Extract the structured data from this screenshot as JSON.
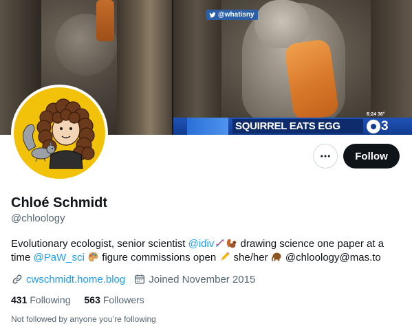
{
  "banner": {
    "twitter_handle": "@whatisny",
    "headline": "SQUIRREL EATS EGG ROLL",
    "time": "6:24 36°",
    "station": "3"
  },
  "profile": {
    "name": "Chloé Schmidt",
    "handle": "@chloology",
    "bio": {
      "part1": "Evolutionary ecologist, senior scientist ",
      "link1": "@idiv",
      "part2": " drawing science one paper at a time ",
      "link2": "@PaW_sci",
      "part3": " figure commissions open ",
      "part4": " she/her ",
      "part5": " @chloology@mas.to"
    },
    "website": "cwschmidt.home.blog",
    "joined": "Joined November 2015",
    "following_count": "431",
    "following_label": "Following",
    "followers_count": "563",
    "followers_label": "Followers",
    "not_followed_text": "Not followed by anyone you’re following"
  },
  "actions": {
    "follow_label": "Follow"
  },
  "colors": {
    "link": "#1d9bf0",
    "follow_button_bg": "#0f1419",
    "avatar_bg": "#f2c20b",
    "secondary_text": "#536471"
  },
  "icons": {
    "more": "more-horizontal-icon",
    "link": "link-icon",
    "calendar": "calendar-icon",
    "dna": "dna-icon",
    "squirrel": "squirrel-emoji-icon",
    "palette": "palette-emoji-icon",
    "pencil": "pencil-emoji-icon",
    "mammoth": "mammoth-emoji-icon"
  }
}
